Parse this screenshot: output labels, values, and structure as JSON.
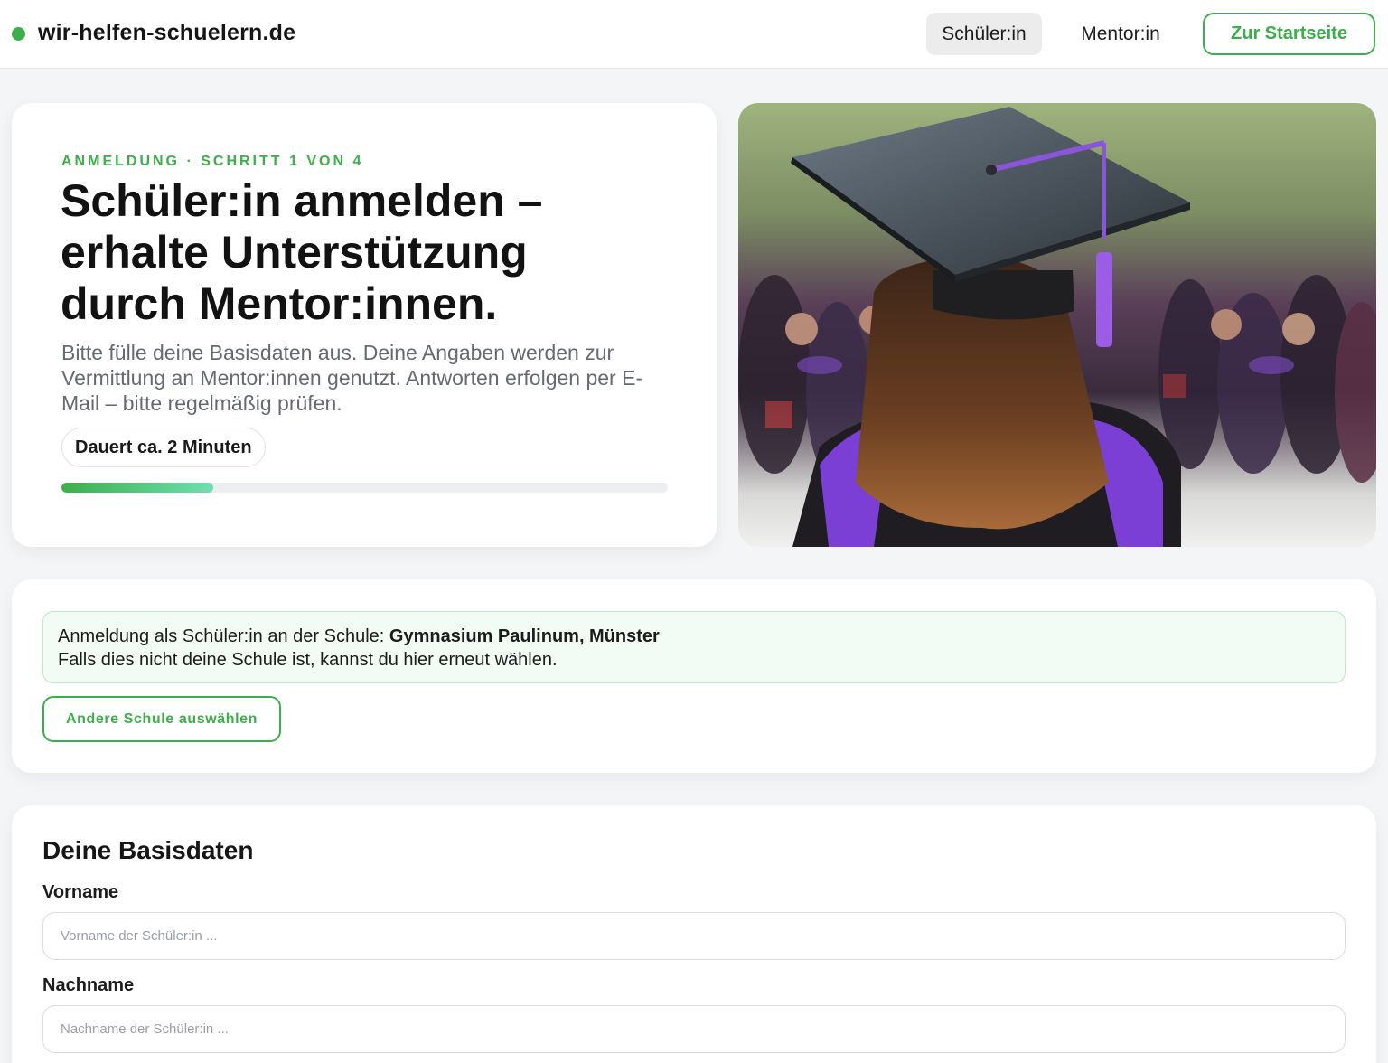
{
  "header": {
    "brand": "wir-helfen-schuelern.de",
    "nav_student": "Schüler:in",
    "nav_mentor": "Mentor:in",
    "home_button": "Zur Startseite"
  },
  "hero": {
    "eyebrow": "ANMELDUNG · SCHRITT 1 VON 4",
    "title": "Schüler:in anmelden – erhalte Unterstützung durch Mentor:innen.",
    "text": "Bitte fülle deine Basisdaten aus. Deine Angaben werden zur Vermittlung an Mentor:innen genutzt. Antworten erfolgen per E-Mail – bitte regelmäßig prüfen.",
    "duration": "Dauert ca. 2 Minuten",
    "progress_fraction": 0.25
  },
  "school": {
    "notice_prefix": "Anmeldung als Schüler:in an der Schule: ",
    "school_name": "Gymnasium Paulinum, Münster",
    "notice_line2": "Falls dies nicht deine Schule ist, kannst du hier erneut wählen.",
    "change_button": "Andere Schule auswählen"
  },
  "form": {
    "title": "Deine Basisdaten",
    "firstname_label": "Vorname",
    "firstname_placeholder": "Vorname der Schüler:in ...",
    "firstname_value": "",
    "lastname_label": "Nachname",
    "lastname_placeholder": "Nachname der Schüler:in ...",
    "lastname_value": ""
  },
  "colors": {
    "accent": "#3cae4a",
    "page_bg": "#f4f5f7",
    "notice_bg": "#f2fcf4"
  }
}
